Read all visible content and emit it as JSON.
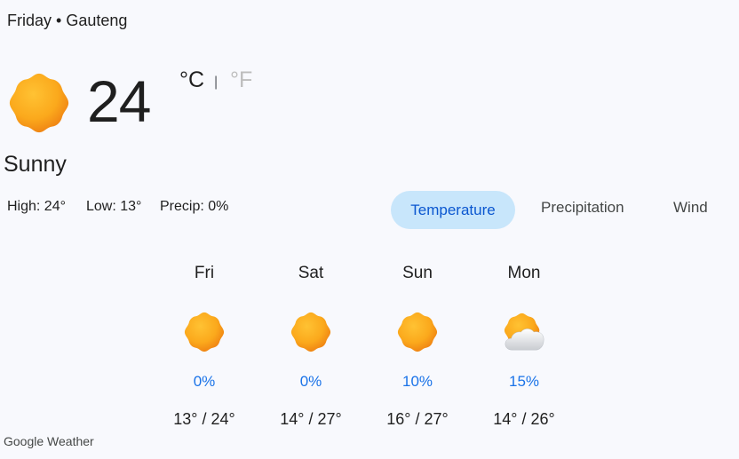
{
  "header": {
    "location": "Friday • Gauteng"
  },
  "current": {
    "temperature": "24",
    "unit_c": "°C",
    "unit_separator": "|",
    "unit_f": "°F",
    "condition": "Sunny",
    "icon": "sun-icon",
    "high": "High: 24°",
    "low": "Low: 13°",
    "precip": "Precip: 0%"
  },
  "tabs": [
    {
      "label": "Temperature",
      "selected": true
    },
    {
      "label": "Precipitation",
      "selected": false
    },
    {
      "label": "Wind",
      "selected": false
    }
  ],
  "forecast": [
    {
      "day": "Fri",
      "icon": "sun-icon",
      "precip": "0%",
      "range": "13° / 24°"
    },
    {
      "day": "Sat",
      "icon": "sun-icon",
      "precip": "0%",
      "range": "14° / 27°"
    },
    {
      "day": "Sun",
      "icon": "sun-icon",
      "precip": "10%",
      "range": "16° / 27°"
    },
    {
      "day": "Mon",
      "icon": "partly-cloudy-icon",
      "precip": "15%",
      "range": "14° / 26°"
    }
  ],
  "footer": {
    "source": "Google Weather"
  },
  "colors": {
    "background": "#f8f9fd",
    "selected_tab_bg": "#c8e6fb",
    "selected_tab_text": "#0b57d0",
    "precip_text": "#1a73e8",
    "sun": "#f9a11b"
  }
}
